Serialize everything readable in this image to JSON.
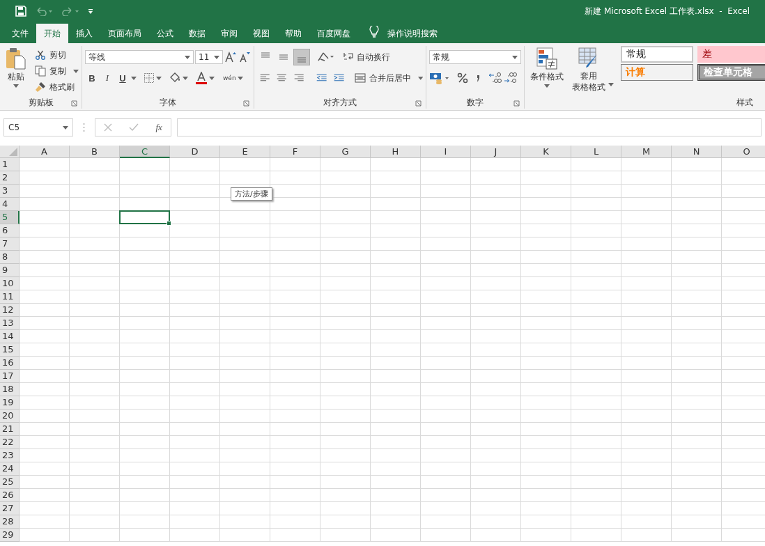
{
  "window": {
    "title": "新建 Microsoft Excel 工作表.xlsx  -  Excel"
  },
  "tabs": [
    {
      "label": "文件",
      "selected": false
    },
    {
      "label": "开始",
      "selected": true
    },
    {
      "label": "插入",
      "selected": false
    },
    {
      "label": "页面布局",
      "selected": false
    },
    {
      "label": "公式",
      "selected": false
    },
    {
      "label": "数据",
      "selected": false
    },
    {
      "label": "审阅",
      "selected": false
    },
    {
      "label": "视图",
      "selected": false
    },
    {
      "label": "帮助",
      "selected": false
    },
    {
      "label": "百度网盘",
      "selected": false
    }
  ],
  "tell_me": {
    "placeholder": "操作说明搜索"
  },
  "clipboard": {
    "label": "剪贴板",
    "paste": "粘贴",
    "cut": "剪切",
    "copy": "复制",
    "format_painter": "格式刷"
  },
  "font": {
    "label": "字体",
    "family": "等线",
    "size": "11",
    "bold": "B",
    "italic": "I",
    "underline": "U",
    "phonetic": "wén"
  },
  "alignment": {
    "label": "对齐方式",
    "wrap_text": "自动换行",
    "merge_center": "合并后居中",
    "vertical": [
      {
        "pressed": false
      },
      {
        "pressed": false
      },
      {
        "pressed": true
      }
    ]
  },
  "number": {
    "label": "数字",
    "format": "常规"
  },
  "styles": {
    "label": "样式",
    "conditional": "条件格式",
    "table_format": [
      "套用",
      "表格格式"
    ],
    "gallery": [
      {
        "label": "常规",
        "kind": "normal"
      },
      {
        "label": "差",
        "kind": "bad"
      },
      {
        "label": "计算",
        "kind": "calculation"
      },
      {
        "label": "检查单元格",
        "kind": "check"
      }
    ]
  },
  "formula_bar": {
    "name_box": "C5",
    "fx": "fx"
  },
  "columns": [
    {
      "label": "A",
      "selected": false
    },
    {
      "label": "B",
      "selected": false
    },
    {
      "label": "C",
      "selected": true
    },
    {
      "label": "D",
      "selected": false
    },
    {
      "label": "E",
      "selected": false
    },
    {
      "label": "F",
      "selected": false
    },
    {
      "label": "G",
      "selected": false
    },
    {
      "label": "H",
      "selected": false
    },
    {
      "label": "I",
      "selected": false
    },
    {
      "label": "J",
      "selected": false
    },
    {
      "label": "K",
      "selected": false
    },
    {
      "label": "L",
      "selected": false
    },
    {
      "label": "M",
      "selected": false
    },
    {
      "label": "N",
      "selected": false
    },
    {
      "label": "O",
      "selected": false
    }
  ],
  "rows": [
    {
      "label": "1",
      "selected": false
    },
    {
      "label": "2",
      "selected": false
    },
    {
      "label": "3",
      "selected": false
    },
    {
      "label": "4",
      "selected": false
    },
    {
      "label": "5",
      "selected": true
    },
    {
      "label": "6",
      "selected": false
    },
    {
      "label": "7",
      "selected": false
    },
    {
      "label": "8",
      "selected": false
    },
    {
      "label": "9",
      "selected": false
    },
    {
      "label": "10",
      "selected": false
    },
    {
      "label": "11",
      "selected": false
    },
    {
      "label": "12",
      "selected": false
    },
    {
      "label": "13",
      "selected": false
    },
    {
      "label": "14",
      "selected": false
    },
    {
      "label": "15",
      "selected": false
    },
    {
      "label": "16",
      "selected": false
    },
    {
      "label": "17",
      "selected": false
    },
    {
      "label": "18",
      "selected": false
    },
    {
      "label": "19",
      "selected": false
    },
    {
      "label": "20",
      "selected": false
    },
    {
      "label": "21",
      "selected": false
    },
    {
      "label": "22",
      "selected": false
    },
    {
      "label": "23",
      "selected": false
    },
    {
      "label": "24",
      "selected": false
    },
    {
      "label": "25",
      "selected": false
    },
    {
      "label": "26",
      "selected": false
    },
    {
      "label": "27",
      "selected": false
    },
    {
      "label": "28",
      "selected": false
    },
    {
      "label": "29",
      "selected": false
    }
  ],
  "tooltip": {
    "text": "方法/步骤"
  }
}
